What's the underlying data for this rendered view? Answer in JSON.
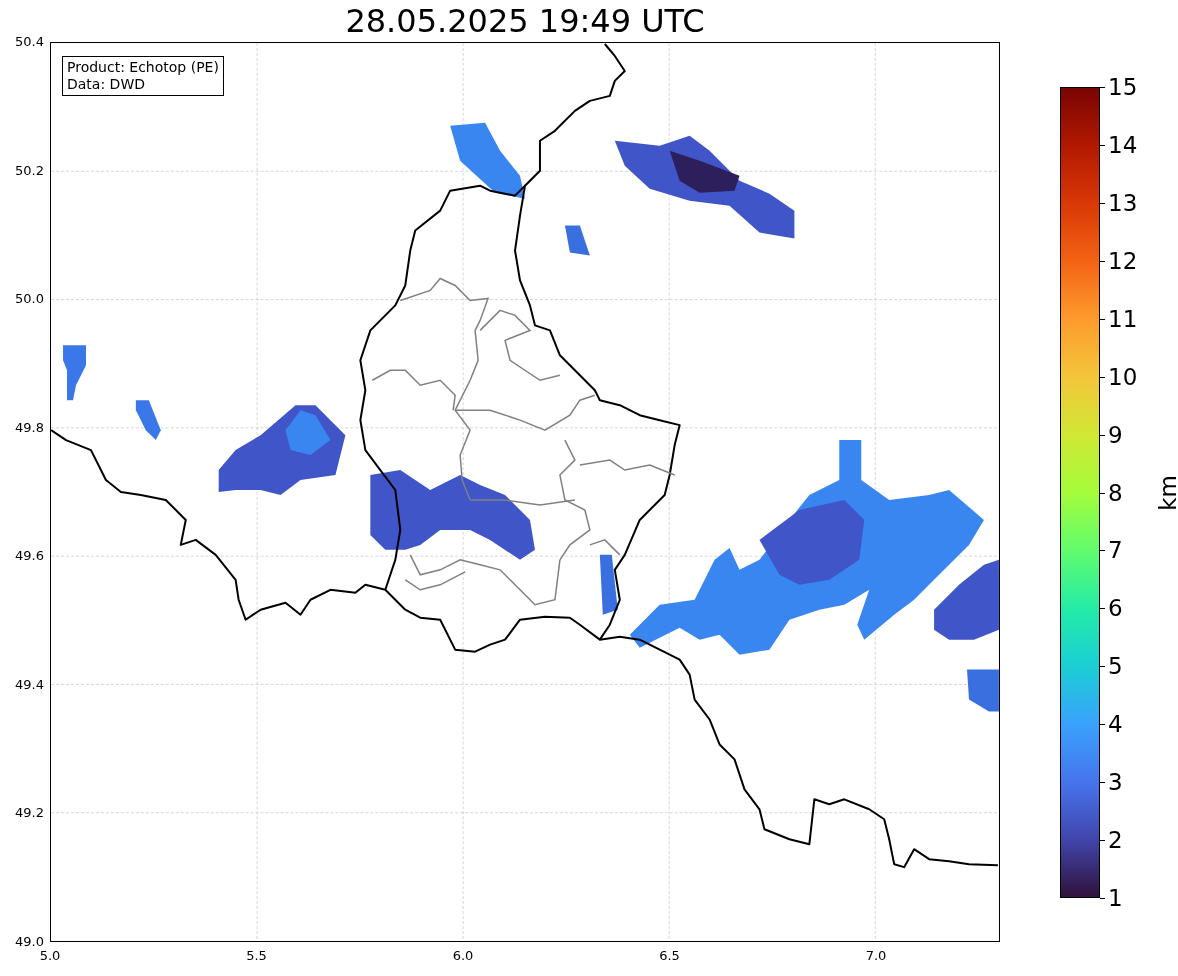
{
  "title": "28.05.2025 19:49 UTC",
  "legend": [
    "Product: Echotop (PE)",
    "Data: DWD"
  ],
  "map": {
    "xticks": [
      "5.0",
      "5.5",
      "6.0",
      "6.5",
      "7.0"
    ],
    "yticks": [
      "50.4",
      "50.2",
      "50.0",
      "49.8",
      "49.6",
      "49.4",
      "49.2",
      "49.0"
    ]
  },
  "colorbar": {
    "label": "km",
    "ticks": [
      "15",
      "14",
      "13",
      "12",
      "11",
      "10",
      "9",
      "8",
      "7",
      "6",
      "5",
      "4",
      "3",
      "2",
      "1"
    ]
  }
}
